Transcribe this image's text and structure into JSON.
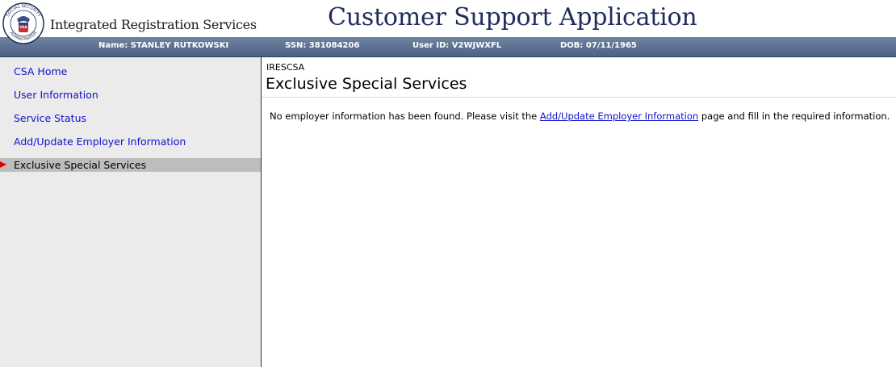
{
  "header": {
    "brand_title": "Integrated Registration Services",
    "app_title": "Customer Support Application",
    "seal": {
      "top_text": "SOCIAL SECURITY",
      "bottom_text": "ADMINISTRATION",
      "center_text": "USA"
    }
  },
  "user_info": {
    "name": "Name: STANLEY RUTKOWSKI",
    "ssn": "SSN: 381084206",
    "user_id": "User ID: V2WJWXFL",
    "dob": "DOB: 07/11/1965"
  },
  "sidebar": {
    "items": [
      {
        "label": "CSA Home"
      },
      {
        "label": "User Information"
      },
      {
        "label": "Service Status"
      },
      {
        "label": "Add/Update Employer Information"
      },
      {
        "label": "Exclusive Special Services",
        "active": true
      }
    ]
  },
  "main": {
    "breadcrumb": "IRESCSA",
    "heading": "Exclusive Special Services",
    "message_before": "No employer information has been found. Please visit the ",
    "message_link": "Add/Update Employer Information",
    "message_after": " page and fill in the required information."
  },
  "colors": {
    "link": "#1111cc",
    "title": "#1f2d5c",
    "infobar": "#5a6f90",
    "sidebar_bg": "#ebebeb",
    "active_bg": "#bdbdbd",
    "arrow": "#e00000"
  }
}
